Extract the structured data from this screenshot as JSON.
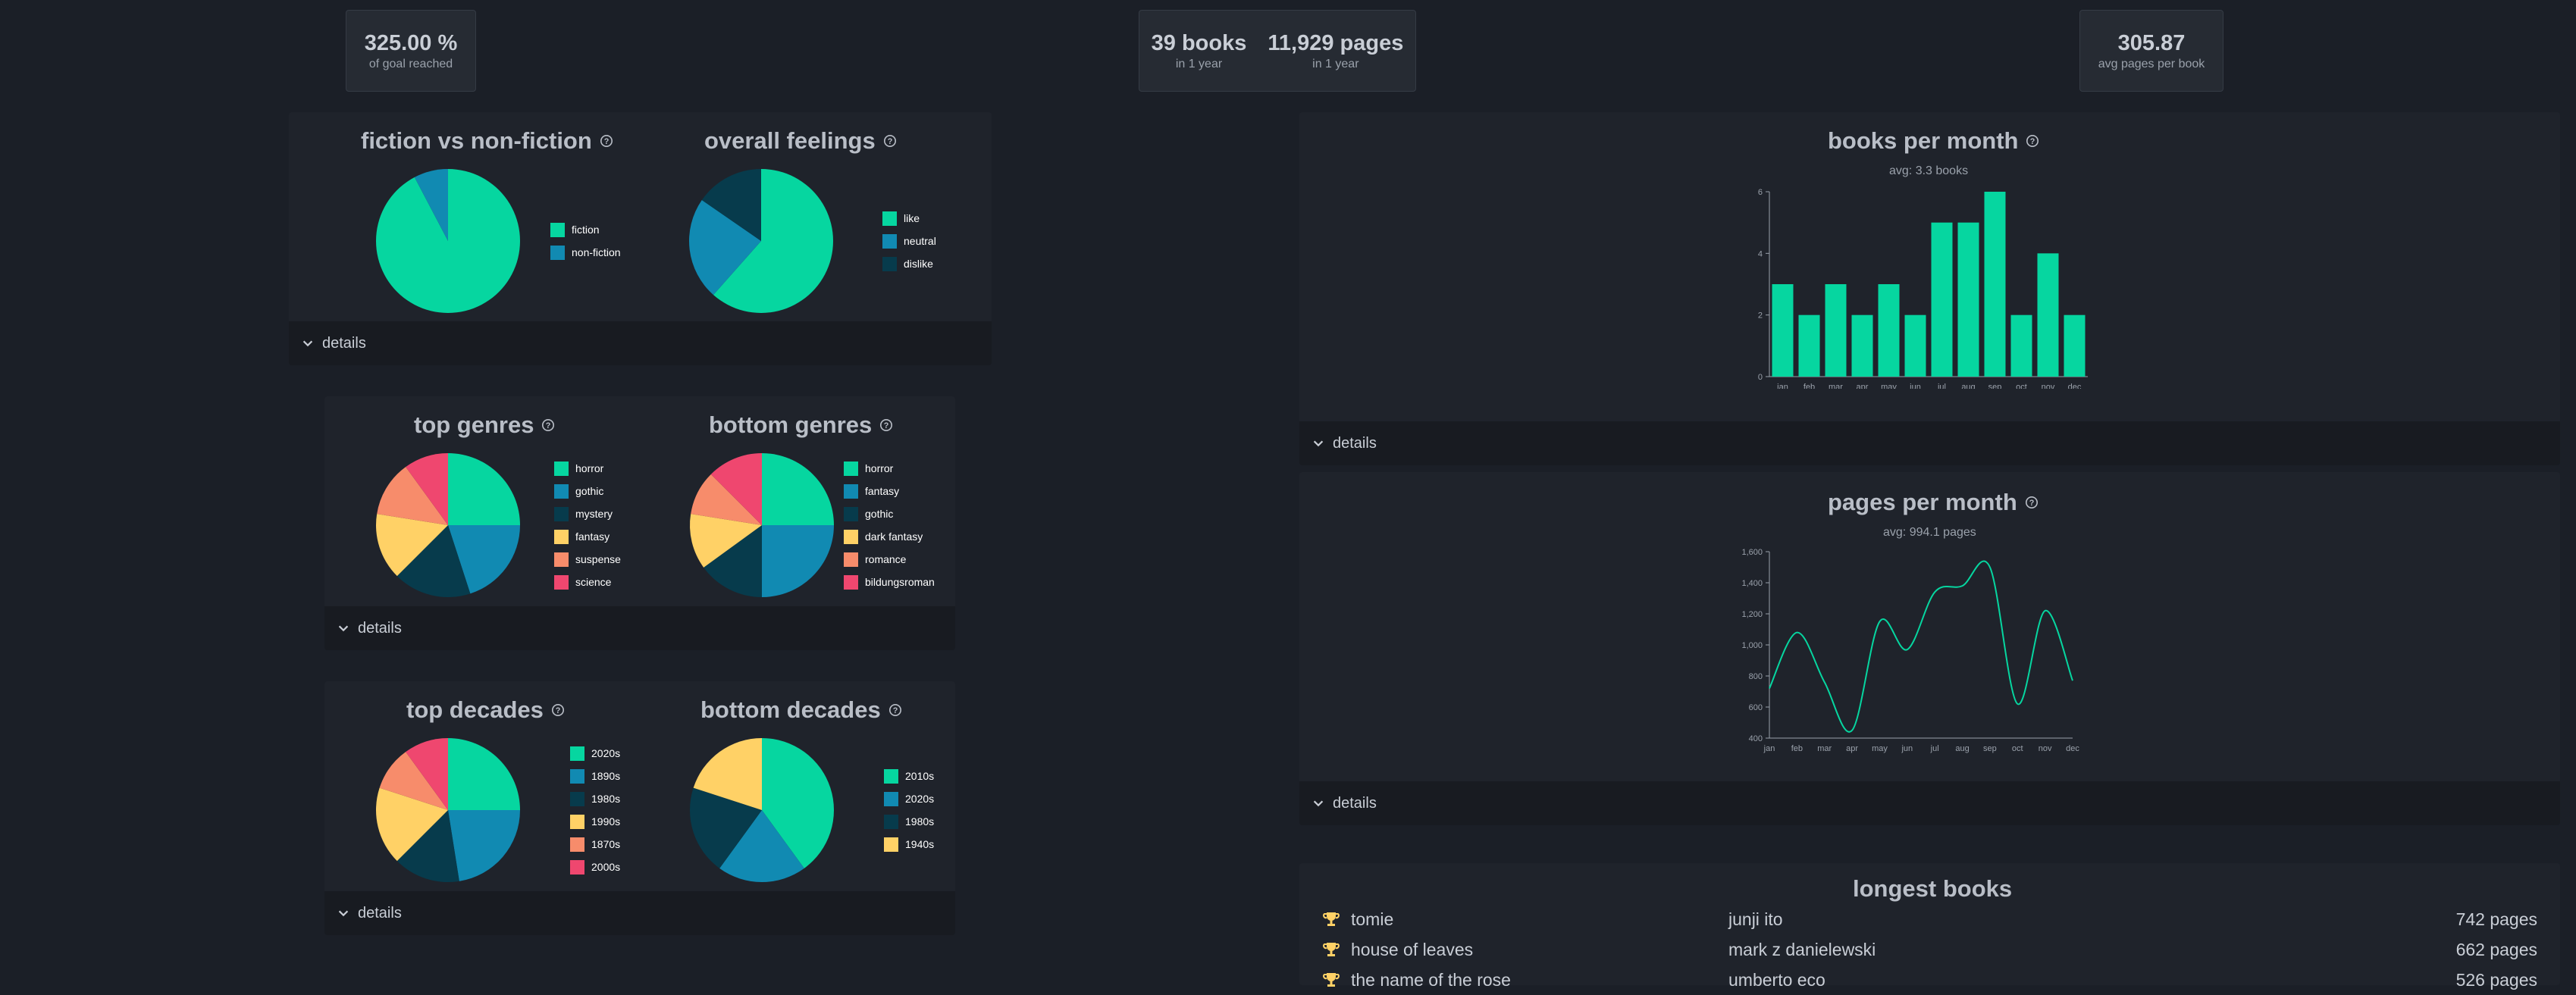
{
  "stats": {
    "goal": {
      "value": "325.00 %",
      "label": "of goal reached"
    },
    "books": {
      "value": "39 books",
      "label": "in 1 year"
    },
    "pages": {
      "value": "11,929 pages",
      "label": "in 1 year"
    },
    "avg": {
      "value": "305.87",
      "label": "avg pages per book"
    }
  },
  "details_label": "details",
  "colors": {
    "c1": "#06d6a0",
    "c2": "#118ab2",
    "c3": "#073b4c",
    "c4": "#ffd166",
    "c5": "#f78c6b",
    "c6": "#ef476f"
  },
  "pies": {
    "fiction": {
      "title": "fiction vs non-fiction",
      "items": [
        {
          "label": "fiction",
          "value": 36
        },
        {
          "label": "non-fiction",
          "value": 3
        }
      ]
    },
    "feelings": {
      "title": "overall feelings",
      "items": [
        {
          "label": "like",
          "value": 24
        },
        {
          "label": "neutral",
          "value": 9
        },
        {
          "label": "dislike",
          "value": 6
        }
      ]
    },
    "top_genres": {
      "title": "top genres",
      "items": [
        {
          "label": "horror",
          "value": 10
        },
        {
          "label": "gothic",
          "value": 8
        },
        {
          "label": "mystery",
          "value": 7
        },
        {
          "label": "fantasy",
          "value": 6
        },
        {
          "label": "suspense",
          "value": 5
        },
        {
          "label": "science",
          "value": 4
        }
      ]
    },
    "bottom_genres": {
      "title": "bottom genres",
      "items": [
        {
          "label": "horror",
          "value": 10
        },
        {
          "label": "fantasy",
          "value": 10
        },
        {
          "label": "gothic",
          "value": 6
        },
        {
          "label": "dark fantasy",
          "value": 5
        },
        {
          "label": "romance",
          "value": 4
        },
        {
          "label": "bildungsroman",
          "value": 5
        }
      ]
    },
    "top_decades": {
      "title": "top decades",
      "items": [
        {
          "label": "2020s",
          "value": 10
        },
        {
          "label": "1890s",
          "value": 9
        },
        {
          "label": "1980s",
          "value": 6
        },
        {
          "label": "1990s",
          "value": 7
        },
        {
          "label": "1870s",
          "value": 4
        },
        {
          "label": "2000s",
          "value": 4
        }
      ]
    },
    "bottom_decades": {
      "title": "bottom decades",
      "items": [
        {
          "label": "2010s",
          "value": 10
        },
        {
          "label": "2020s",
          "value": 5
        },
        {
          "label": "1980s",
          "value": 5
        },
        {
          "label": "1940s",
          "value": 5
        }
      ]
    }
  },
  "chart_data": [
    {
      "type": "bar",
      "title": "books per month",
      "subtitle": "avg: 3.3 books",
      "categories": [
        "jan",
        "feb",
        "mar",
        "apr",
        "may",
        "jun",
        "jul",
        "aug",
        "sep",
        "oct",
        "nov",
        "dec"
      ],
      "values": [
        3,
        2,
        3,
        2,
        3,
        2,
        5,
        5,
        6,
        2,
        4,
        2
      ],
      "ylim": [
        0,
        6
      ],
      "yticks": [
        "0",
        "2",
        "4",
        "6"
      ]
    },
    {
      "type": "line",
      "title": "pages per month",
      "subtitle": "avg: 994.1 pages",
      "categories": [
        "jan",
        "feb",
        "mar",
        "apr",
        "may",
        "jun",
        "jul",
        "aug",
        "sep",
        "oct",
        "nov",
        "dec"
      ],
      "values": [
        720,
        1080,
        760,
        450,
        1150,
        970,
        1340,
        1380,
        1500,
        620,
        1220,
        770
      ],
      "ylim": [
        400,
        1600
      ],
      "yticks": [
        "400",
        "600",
        "800",
        "1,000",
        "1,200",
        "1,400",
        "1,600"
      ]
    }
  ],
  "longest": {
    "title": "longest books",
    "rows": [
      {
        "title": "tomie",
        "author": "junji ito",
        "pages": "742 pages"
      },
      {
        "title": "house of leaves",
        "author": "mark z danielewski",
        "pages": "662 pages"
      },
      {
        "title": "the name of the rose",
        "author": "umberto eco",
        "pages": "526 pages"
      }
    ]
  }
}
